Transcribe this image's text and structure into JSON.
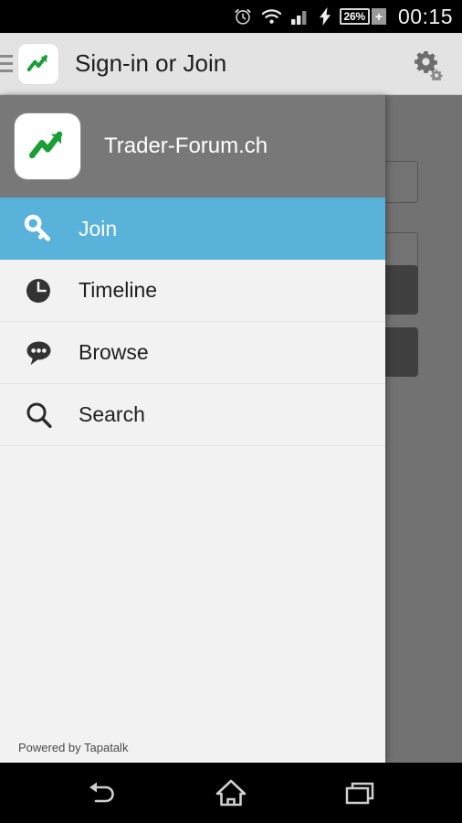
{
  "statusbar": {
    "icons": [
      "alarm-clock-icon",
      "wifi-icon",
      "cellular-signal-icon",
      "charging-bolt-icon"
    ],
    "battery_percent": "26%",
    "battery_plus": "+",
    "time": "00:15"
  },
  "appbar": {
    "menu_icon": "hamburger-icon",
    "logo_icon": "trader-forum-logo",
    "title": "Sign-in or Join",
    "settings_icon": "gear-icon"
  },
  "drawer": {
    "site_logo": "trader-forum-logo",
    "site_name": "Trader-Forum.ch",
    "items": [
      {
        "label": "Join",
        "icon": "key-icon",
        "active": true
      },
      {
        "label": "Timeline",
        "icon": "clock-icon",
        "active": false
      },
      {
        "label": "Browse",
        "icon": "speech-bubble-icon",
        "active": false
      },
      {
        "label": "Search",
        "icon": "magnifier-icon",
        "active": false
      }
    ],
    "footer": "Powered by Tapatalk"
  },
  "navbar": {
    "back": "back-icon",
    "home": "home-icon",
    "recents": "recents-icon"
  },
  "colors": {
    "accent_blue": "#58b2da",
    "appbar_bg": "#e3e3e3",
    "drawer_bg": "#f2f2f2",
    "drawer_header_bg": "#787878",
    "logo_green": "#1a9e38",
    "status_bg": "#000000"
  }
}
